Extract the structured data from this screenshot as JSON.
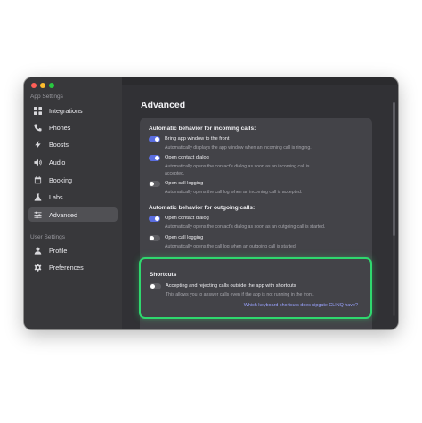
{
  "window": {
    "traffic_lights": {
      "close": "#ff5f57",
      "minimize": "#febc2e",
      "maximize": "#28c840"
    }
  },
  "sidebar": {
    "app_settings_title": "App Settings",
    "items": [
      {
        "label": "Integrations",
        "icon": "grid-icon"
      },
      {
        "label": "Phones",
        "icon": "phone-icon"
      },
      {
        "label": "Boosts",
        "icon": "bolt-icon"
      },
      {
        "label": "Audio",
        "icon": "speaker-icon"
      },
      {
        "label": "Booking",
        "icon": "calendar-icon"
      },
      {
        "label": "Labs",
        "icon": "flask-icon"
      },
      {
        "label": "Advanced",
        "icon": "sliders-icon",
        "active": true
      }
    ],
    "user_settings_title": "User Settings",
    "user_items": [
      {
        "label": "Profile",
        "icon": "person-icon"
      },
      {
        "label": "Preferences",
        "icon": "gear-icon"
      }
    ]
  },
  "main": {
    "title": "Advanced",
    "incoming": {
      "title": "Automatic behavior for incoming calls:",
      "options": [
        {
          "label": "Bring app window to the front",
          "desc": "Automatically displays the app window when an incoming call is ringing.",
          "on": true
        },
        {
          "label": "Open contact dialog",
          "desc": "Automatically opens the contact's dialog as soon as an incoming call is",
          "desc2": "accepted.",
          "on": true
        },
        {
          "label": "Open call logging",
          "desc": "Automatically opens the call log when an incoming call is accepted.",
          "on": false
        }
      ]
    },
    "outgoing": {
      "title": "Automatic behavior for outgoing calls:",
      "options": [
        {
          "label": "Open contact dialog",
          "desc": "Automatically opens the contact's dialog as soon as an outgoing call is started.",
          "on": true
        },
        {
          "label": "Open call logging",
          "desc": "Automatically opens the call log when an outgoing call is started.",
          "on": false
        }
      ]
    },
    "shortcuts": {
      "title": "Shortcuts",
      "option": {
        "label": "Accepting and rejecting calls outside the app with shortcuts",
        "desc": "This allows you to answer calls even if the app is not running in the front.",
        "on": false
      },
      "link": "Which keyboard shortcuts does sipgate CLINQ have?"
    }
  },
  "colors": {
    "accent": "#5b6ee1",
    "highlight": "#2fd86e",
    "link": "#9aa3ff"
  }
}
